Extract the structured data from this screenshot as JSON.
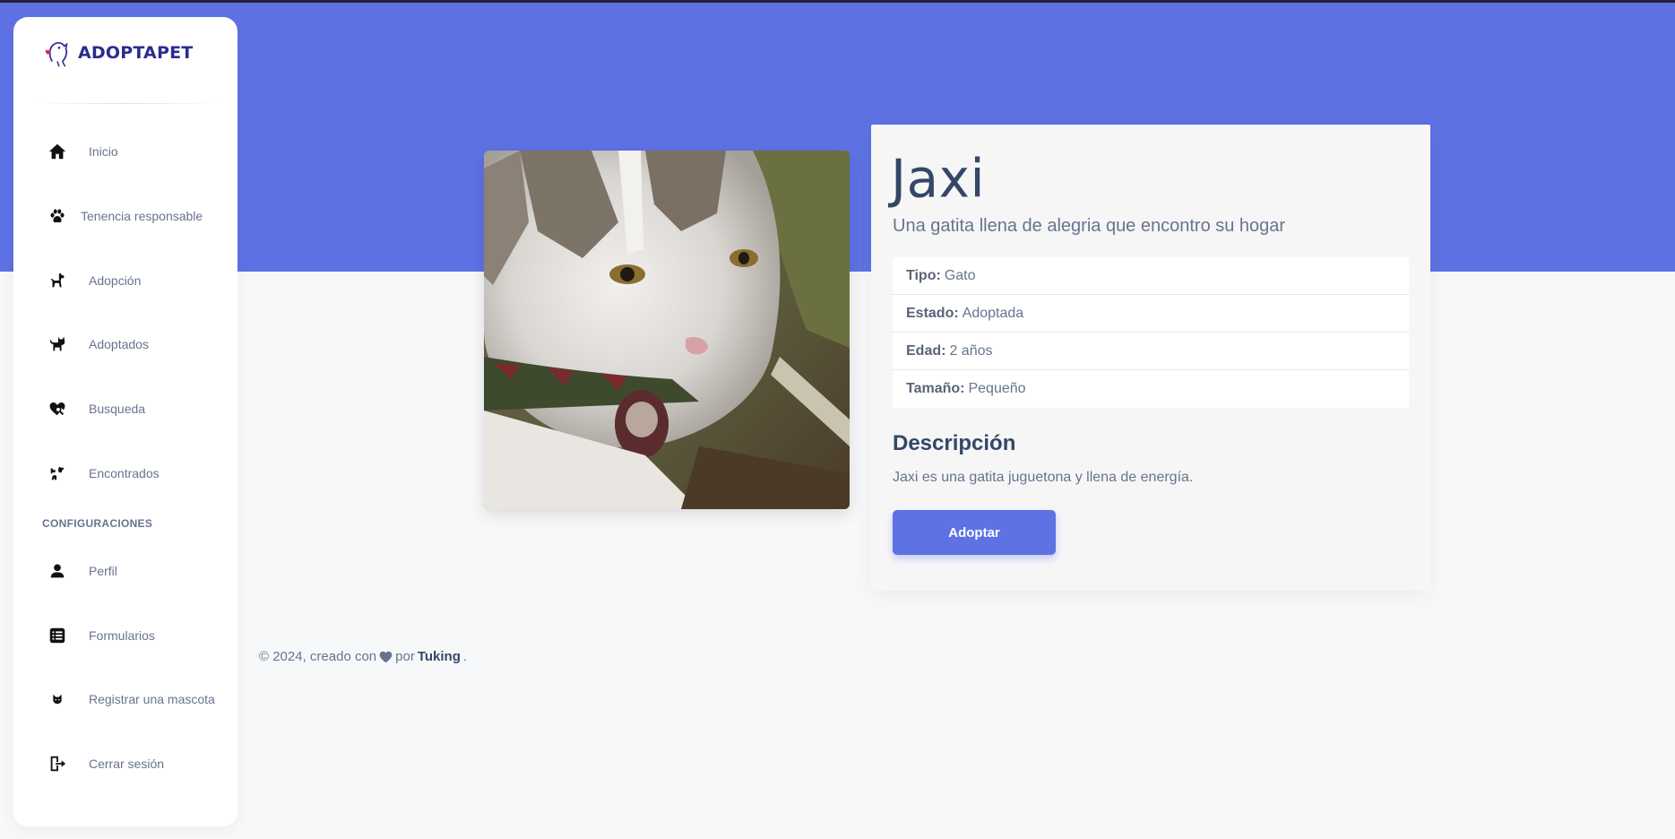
{
  "brand": {
    "name": "ADOPTAPET"
  },
  "sidebar": {
    "items": [
      {
        "label": "Inicio",
        "icon": "house-icon"
      },
      {
        "label": "Tenencia responsable",
        "icon": "paw-icon"
      },
      {
        "label": "Adopción",
        "icon": "dog-icon"
      },
      {
        "label": "Adoptados",
        "icon": "cat-icon"
      },
      {
        "label": "Busqueda",
        "icon": "search-heart-icon"
      },
      {
        "label": "Encontrados",
        "icon": "pets-found-icon"
      }
    ],
    "section_heading": "CONFIGURACIONES",
    "settings_items": [
      {
        "label": "Perfil",
        "icon": "user-icon"
      },
      {
        "label": "Formularios",
        "icon": "list-form-icon"
      },
      {
        "label": "Registrar una mascota",
        "icon": "cat-face-icon"
      },
      {
        "label": "Cerrar sesión",
        "icon": "logout-icon"
      }
    ]
  },
  "pet": {
    "name": "Jaxi",
    "subtitle": "Una gatita llena de alegria que encontro su hogar",
    "attributes": [
      {
        "key": "Tipo:",
        "value": "Gato"
      },
      {
        "key": "Estado:",
        "value": "Adoptada"
      },
      {
        "key": "Edad:",
        "value": "2 años"
      },
      {
        "key": "Tamaño:",
        "value": "Pequeño"
      }
    ],
    "description_title": "Descripción",
    "description": "Jaxi es una gatita juguetona y llena de energía.",
    "adopt_label": "Adoptar"
  },
  "footer": {
    "prefix": "© 2024, creado con",
    "middle": "por",
    "author": "Tuking",
    "suffix": "."
  },
  "colors": {
    "accent": "#5e72e4",
    "background": "#f7f8fa",
    "text": "#67748e",
    "heading": "#344767"
  }
}
